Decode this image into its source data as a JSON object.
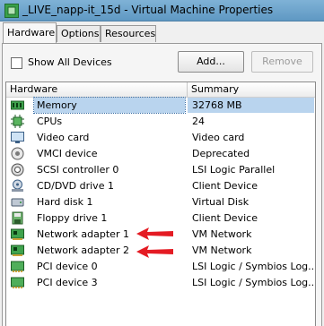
{
  "window": {
    "title": "_LIVE_napp-it_15d - Virtual Machine Properties"
  },
  "tabs": [
    {
      "label": "Hardware",
      "active": true
    },
    {
      "label": "Options",
      "active": false
    },
    {
      "label": "Resources",
      "active": false
    }
  ],
  "toolbar": {
    "show_all_devices_label": "Show All Devices",
    "show_all_devices_checked": false,
    "add_label": "Add...",
    "remove_label": "Remove"
  },
  "table": {
    "columns": [
      "Hardware",
      "Summary"
    ],
    "rows": [
      {
        "icon": "memory-icon",
        "name": "Memory",
        "summary": "32768 MB",
        "selected": true
      },
      {
        "icon": "cpu-icon",
        "name": "CPUs",
        "summary": "24"
      },
      {
        "icon": "monitor-icon",
        "name": "Video card",
        "summary": "Video card"
      },
      {
        "icon": "vmci-icon",
        "name": "VMCI device",
        "summary": "Deprecated"
      },
      {
        "icon": "scsi-icon",
        "name": "SCSI controller 0",
        "summary": "LSI Logic Parallel"
      },
      {
        "icon": "cd-drive-icon",
        "name": "CD/DVD drive 1",
        "summary": "Client Device"
      },
      {
        "icon": "hard-disk-icon",
        "name": "Hard disk 1",
        "summary": "Virtual Disk"
      },
      {
        "icon": "floppy-icon",
        "name": "Floppy drive 1",
        "summary": "Client Device"
      },
      {
        "icon": "network-adapter-icon",
        "name": "Network adapter 1",
        "summary": "VM Network"
      },
      {
        "icon": "network-adapter-icon",
        "name": "Network adapter 2",
        "summary": "VM Network"
      },
      {
        "icon": "pci-device-icon",
        "name": "PCI device 0",
        "summary": "LSI Logic / Symbios Log..."
      },
      {
        "icon": "pci-device-icon",
        "name": "PCI device 3",
        "summary": "LSI Logic / Symbios Log..."
      }
    ]
  },
  "colors": {
    "annotation_arrow": "#e41b23",
    "selection": "#b9d4ee"
  }
}
